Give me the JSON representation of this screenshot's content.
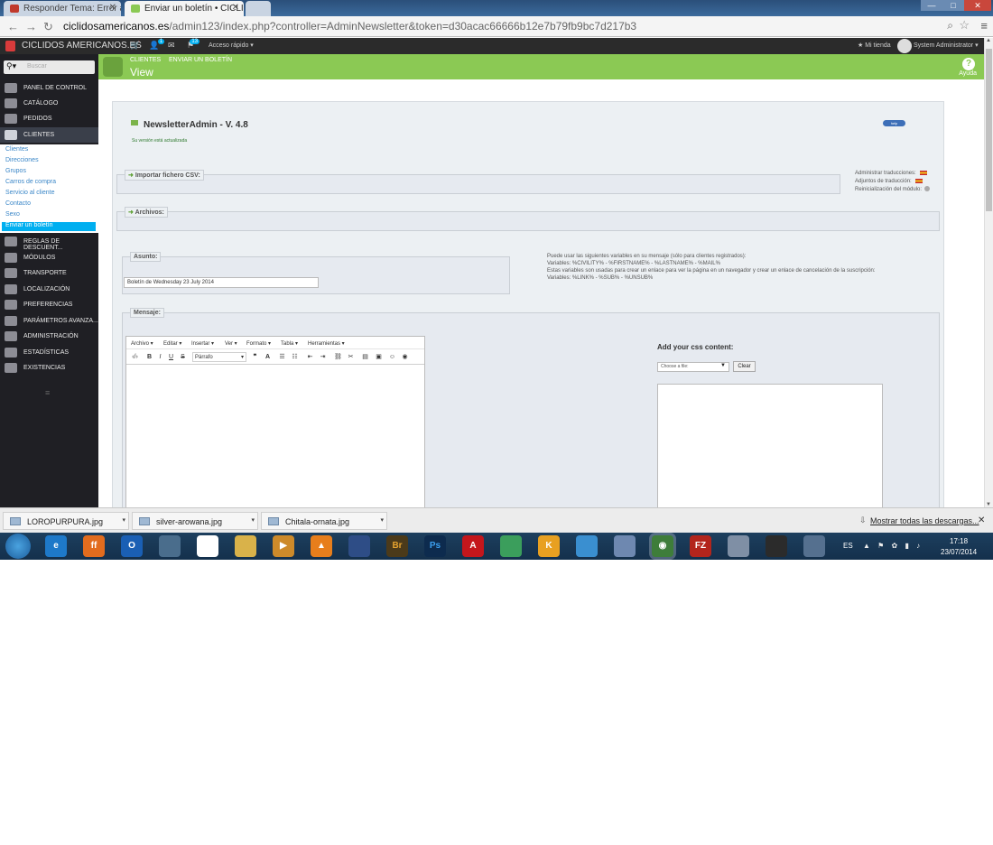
{
  "browser": {
    "tabs": [
      {
        "title": "Responder Tema: Error al"
      },
      {
        "title": "Enviar un boletín • CICLID"
      },
      {
        "title": ""
      }
    ],
    "url_host": "ciclidosamericanos.es",
    "url_path": "/admin123/index.php?controller=AdminNewsletter&token=d30acac66666b12e7b79fb9bc7d217b3",
    "window_controls": {
      "minimize": "—",
      "maximize": "□",
      "close": "✕"
    }
  },
  "header": {
    "shop_name": "CICLIDOS AMERICANOS.ES",
    "badges": {
      "customers": "1",
      "messages": "13"
    },
    "quick_access": "Acceso rápido ▾",
    "my_shop": "★ Mi tienda",
    "admin_name": "System Administrator ▾"
  },
  "sidebar": {
    "search_placeholder": "Buscar",
    "menu": [
      {
        "label": "PANEL DE CONTROL"
      },
      {
        "label": "CATÁLOGO"
      },
      {
        "label": "PEDIDOS"
      },
      {
        "label": "CLIENTES"
      },
      {
        "label": "REGLAS DE DESCUENT..."
      },
      {
        "label": "MÓDULOS"
      },
      {
        "label": "TRANSPORTE"
      },
      {
        "label": "LOCALIZACIÓN"
      },
      {
        "label": "PREFERENCIAS"
      },
      {
        "label": "PARÁMETROS AVANZA..."
      },
      {
        "label": "ADMINISTRACIÓN"
      },
      {
        "label": "ESTADÍSTICAS"
      },
      {
        "label": "EXISTENCIAS"
      }
    ],
    "submenu": [
      {
        "label": "Clientes"
      },
      {
        "label": "Direcciones"
      },
      {
        "label": "Grupos"
      },
      {
        "label": "Carros de compra"
      },
      {
        "label": "Servicio al cliente"
      },
      {
        "label": "Contacto"
      },
      {
        "label": "Sexo"
      },
      {
        "label": "Enviar un boletín"
      }
    ]
  },
  "page_head": {
    "breadcrumb": [
      "CLIENTES",
      "ENVIAR UN BOLETÍN"
    ],
    "title": "View",
    "help_label": "Ayuda"
  },
  "module": {
    "title": "NewsletterAdmin - V. 4.8",
    "status": "Su versión está actualizada",
    "help_button": "help",
    "import_legend": "Importar fichero CSV:",
    "files_legend": "Archivos:",
    "translations": {
      "admin": "Administrar traducciones:",
      "attachments": "Adjuntos de traducción:",
      "reset": "Reinicialización del módulo:"
    },
    "subject_legend": "Asunto:",
    "subject_value": "Boletín de Wednesday 23 July 2014",
    "variables_text": [
      "Puede usar las siguientes variables en su mensaje (sólo para clientes registrados):",
      "Variables: %CIVILITY% - %FIRSTNAME% - %LASTNAME% - %MAIL%",
      "Estas variables son usadas para crear un enlace para ver la página en un navegador y crear un enlace de cancelación de la suscripción:",
      "Variables: %LINK% - %SUB% - %UNSUB%"
    ],
    "message_legend": "Mensaje:",
    "editor_menu": [
      "Archivo ▾",
      "Editar ▾",
      "Insertar ▾",
      "Ver ▾",
      "Formato ▾",
      "Tabla ▾",
      "Herramientas ▾"
    ],
    "editor_format": "Párrafo",
    "css_title": "Add your css content:",
    "css_select": "Choose a file:",
    "clear_button": "Clear"
  },
  "downloads": {
    "files": [
      "LOROPURPURA.jpg",
      "silver-arowana.jpg",
      "Chitala-ornata.jpg"
    ],
    "show_all": "Mostrar todas las descargas..."
  },
  "taskbar": {
    "apps": [
      "e",
      "ff",
      "O",
      "",
      "",
      "",
      "▶",
      "▲",
      "",
      "Br",
      "Ps",
      "A",
      "",
      "K",
      "",
      "",
      "◉",
      "FZ",
      "",
      "",
      ""
    ],
    "lang": "ES",
    "time": "17:18",
    "date": "23/07/2014"
  },
  "colors": {
    "accent_green": "#8bc954",
    "sidebar_dark": "#1f1f24",
    "active_blue": "#00aff0"
  }
}
